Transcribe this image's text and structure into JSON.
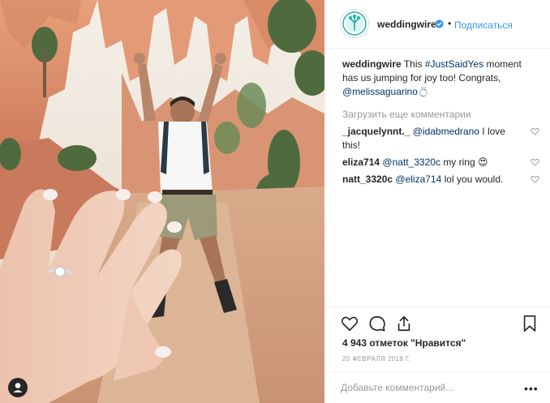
{
  "post": {
    "account": {
      "username": "weddingwire",
      "verified": true,
      "follow_label": "Подписаться",
      "separator": "•"
    },
    "caption": {
      "user": "weddingwire",
      "text_before": "This",
      "hashtag": "#JustSaidYes",
      "text_after": "moment has us jumping for joy too! Congrats,",
      "mention": "@melissaguarino💍"
    },
    "load_more_label": "Загрузить еще комментарии",
    "comments": [
      {
        "user": "_jacquelynnt._",
        "mention": "@idabmedrano",
        "text": "I love this!"
      },
      {
        "user": "eliza714",
        "mention": "@natt_3320c",
        "text": "my ring 😍"
      },
      {
        "user": "natt_3320c",
        "mention": "@eliza714",
        "text": "lol you would."
      }
    ],
    "likes_label": "4 943 отметок \"Нравится\"",
    "date_label": "25 ФЕВРАЛЯ 2018 Г.",
    "add_comment_placeholder": "Добавьте комментарий...",
    "more_label": "•••"
  },
  "icons": {
    "verified": "verified-badge-icon",
    "like": "heart-icon",
    "comment": "comment-bubble-icon",
    "share": "share-icon",
    "save": "bookmark-icon",
    "user_tag": "user-tag-icon",
    "comment_like": "heart-icon",
    "more": "more-options-icon",
    "avatar": "weddingwire-logo"
  },
  "colors": {
    "link": "#003569",
    "follow": "#3897f0",
    "verified": "#3897f0",
    "muted": "#999999",
    "text": "#262626",
    "logo": "#20b2aa"
  }
}
